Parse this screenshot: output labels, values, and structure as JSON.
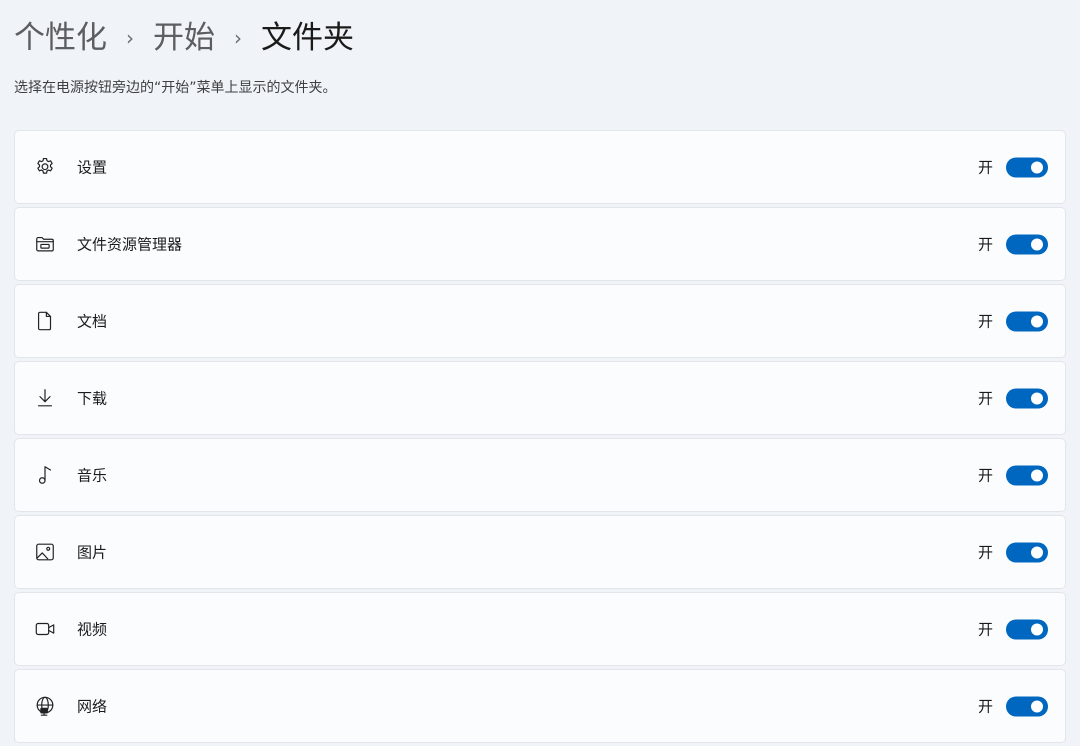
{
  "breadcrumb": {
    "items": [
      "个性化",
      "开始",
      "文件夹"
    ],
    "separator": "›"
  },
  "subtitle": "选择在电源按钮旁边的“开始”菜单上显示的文件夹。",
  "accent_color": "#0067c0",
  "folders": [
    {
      "label": "设置",
      "icon": "gear-icon",
      "state_label": "开",
      "enabled": true
    },
    {
      "label": "文件资源管理器",
      "icon": "folder-icon",
      "state_label": "开",
      "enabled": true
    },
    {
      "label": "文档",
      "icon": "document-icon",
      "state_label": "开",
      "enabled": true
    },
    {
      "label": "下载",
      "icon": "download-icon",
      "state_label": "开",
      "enabled": true
    },
    {
      "label": "音乐",
      "icon": "music-icon",
      "state_label": "开",
      "enabled": true
    },
    {
      "label": "图片",
      "icon": "image-icon",
      "state_label": "开",
      "enabled": true
    },
    {
      "label": "视频",
      "icon": "video-icon",
      "state_label": "开",
      "enabled": true
    },
    {
      "label": "网络",
      "icon": "network-icon",
      "state_label": "开",
      "enabled": true
    }
  ]
}
